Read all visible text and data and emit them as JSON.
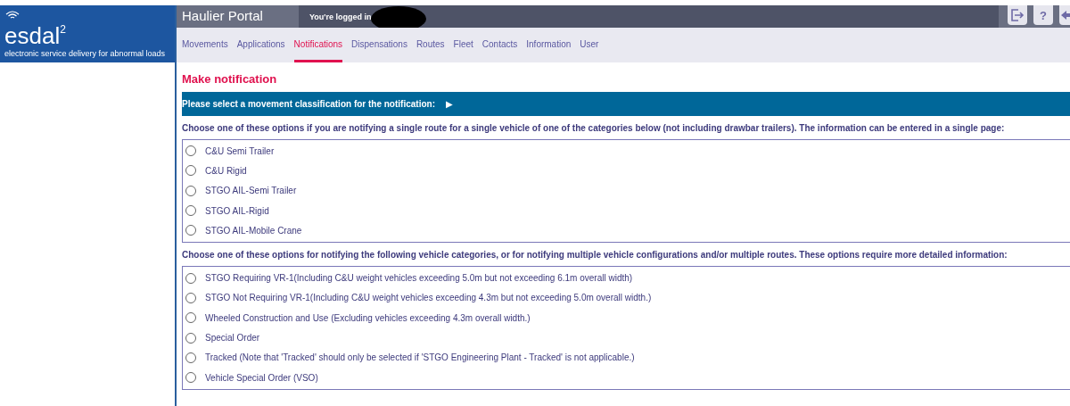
{
  "logo": {
    "name": "esdal$^{2}$",
    "tagline": "electronic service delivery for abnormal loads"
  },
  "header": {
    "title": "Haulier Portal",
    "login_text": "You're logged in",
    "help_label": "?"
  },
  "tabs": [
    {
      "label": "Movements",
      "selected": false
    },
    {
      "label": "Applications",
      "selected": false
    },
    {
      "label": "Notifications",
      "selected": true
    },
    {
      "label": "Dispensations",
      "selected": false
    },
    {
      "label": "Routes",
      "selected": false
    },
    {
      "label": "Fleet",
      "selected": false
    },
    {
      "label": "Contacts",
      "selected": false
    },
    {
      "label": "Information",
      "selected": false
    },
    {
      "label": "User",
      "selected": false
    }
  ],
  "page_title": "Make notification",
  "banner": {
    "text": "Please select a movement classification for the notification:",
    "arrow": "▶"
  },
  "groups": [
    {
      "intro": "Choose one of these options if you are notifying a single route for a single vehicle of one of the categories below (not including drawbar trailers). The information can be entered in a single page:",
      "options": [
        {
          "label": "C&U Semi Trailer",
          "selected": false
        },
        {
          "label": "C&U Rigid",
          "selected": false
        },
        {
          "label": "STGO AIL-Semi Trailer",
          "selected": false
        },
        {
          "label": "STGO AIL-Rigid",
          "selected": false
        },
        {
          "label": "STGO AIL-Mobile Crane",
          "selected": false
        }
      ]
    },
    {
      "intro": "Choose one of these options for notifying the following vehicle categories, or for notifying multiple vehicle configurations and/or multiple routes. These options require more detailed information:",
      "options": [
        {
          "label": "STGO Requiring VR-1(Including C&U weight vehicles exceeding 5.0m but not exceeding 6.1m overall width)",
          "selected": false
        },
        {
          "label": "STGO Not Requiring VR-1(Including C&U weight vehicles exceeding 4.3m but not exceeding 5.0m overall width.)",
          "selected": false
        },
        {
          "label": "Wheeled Construction and Use (Excluding vehicles exceeding 4.3m overall width.)",
          "selected": false
        },
        {
          "label": "Special Order",
          "selected": false
        },
        {
          "label": "Tracked (Note that 'Tracked' should only be selected if 'STGO Engineering Plant - Tracked' is not applicable.)",
          "selected": false
        },
        {
          "label": "Vehicle Special Order (VSO)",
          "selected": false
        }
      ]
    }
  ]
}
